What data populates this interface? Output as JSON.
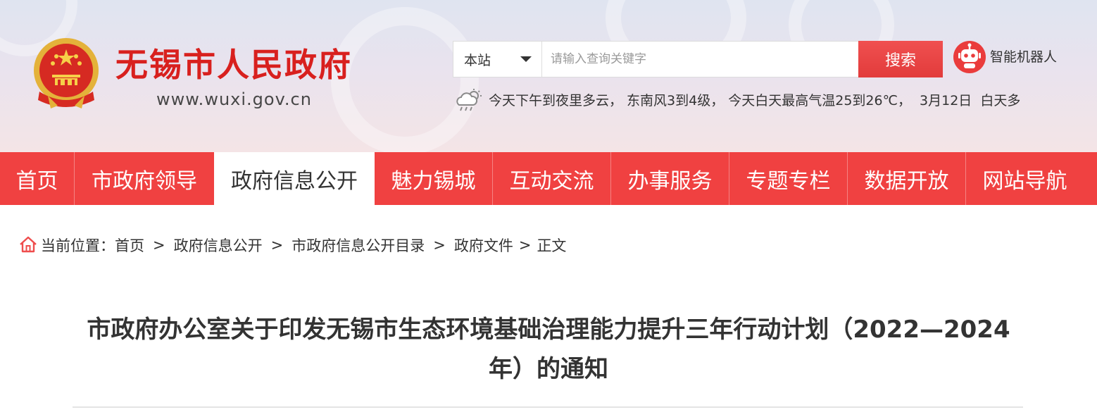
{
  "header": {
    "site_title": "无锡市人民政府",
    "site_url": "www.wuxi.gov.cn",
    "search": {
      "scope": "本站",
      "placeholder": "请输入查询关键字",
      "button": "搜索"
    },
    "robot_label": "智能机器人",
    "weather": "今天下午到夜里多云， 东南风3到4级， 今天白天最高气温25到26℃，  3月12日  白天多"
  },
  "nav": {
    "items": [
      {
        "label": "首页"
      },
      {
        "label": "市政府领导"
      },
      {
        "label": "政府信息公开"
      },
      {
        "label": "魅力锡城"
      },
      {
        "label": "互动交流"
      },
      {
        "label": "办事服务"
      },
      {
        "label": "专题专栏"
      },
      {
        "label": "数据开放"
      },
      {
        "label": "网站导航"
      }
    ],
    "active": "政府信息公开"
  },
  "breadcrumb": {
    "prefix": "当前位置：",
    "items": [
      "首页",
      "政府信息公开",
      "市政府信息公开目录",
      "政府文件",
      "正文"
    ]
  },
  "article": {
    "title": "市政府办公室关于印发无锡市生态环境基础治理能力提升三年行动计划（2022—2024年）的通知"
  },
  "colors": {
    "brand_red": "#f04141",
    "title_red": "#d8201e",
    "text": "#333333"
  },
  "icons": [
    "national-emblem-icon",
    "chevron-down-icon",
    "robot-icon",
    "cloud-weather-icon",
    "home-icon"
  ]
}
